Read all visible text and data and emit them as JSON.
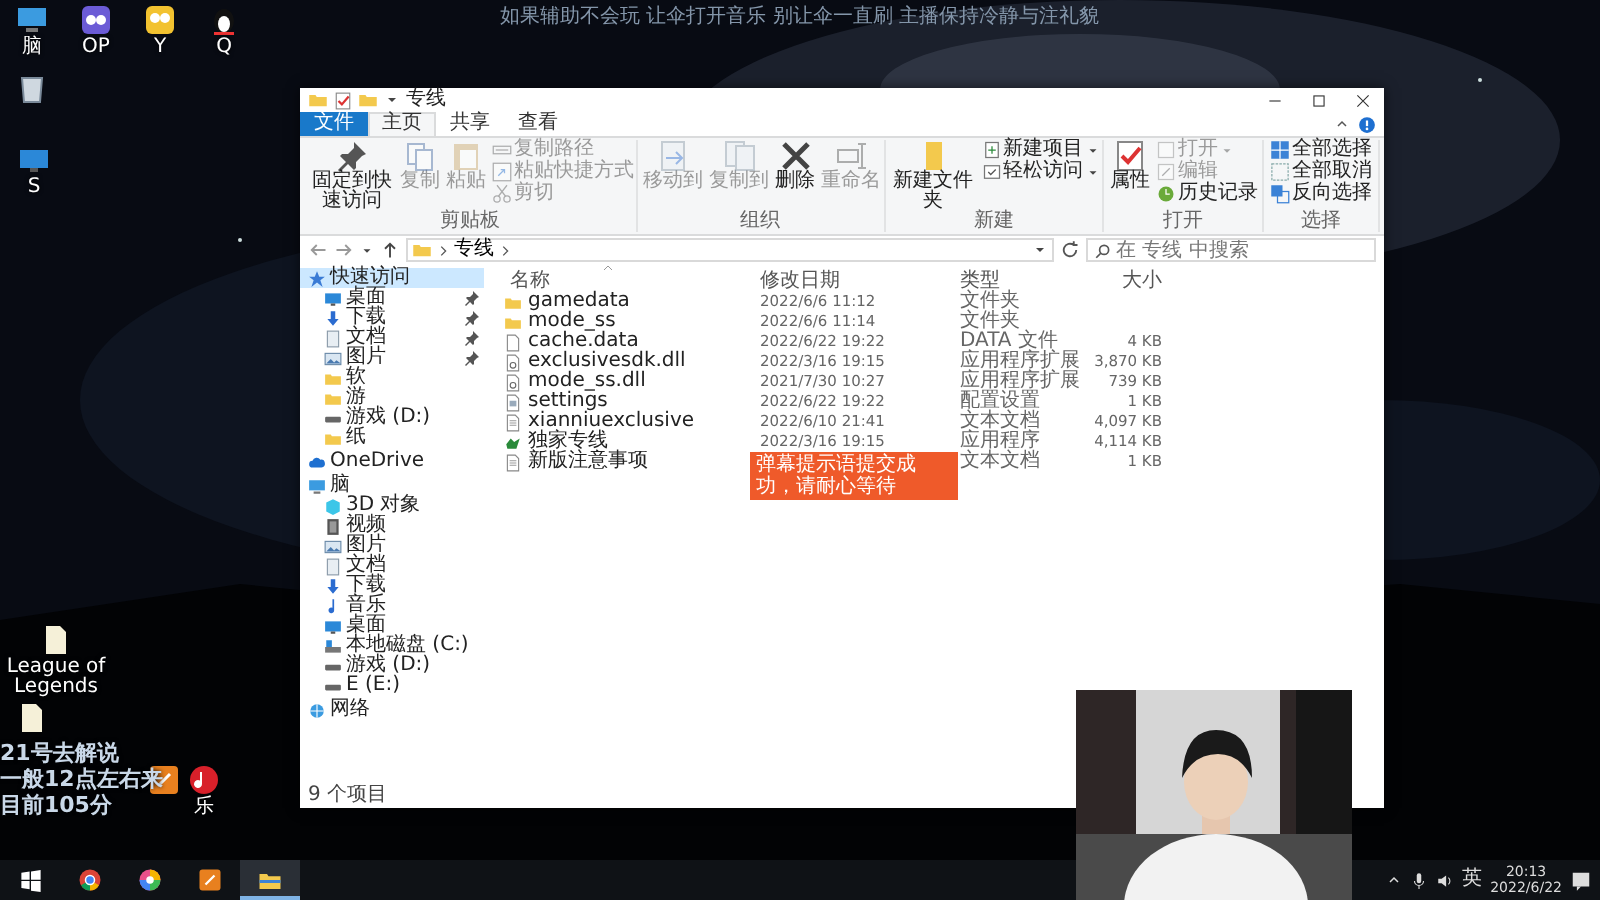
{
  "desktop": {
    "banner": "如果辅助不会玩 让伞打开音乐 别让伞一直刷 主播保持冷静与注礼貌",
    "icons": [
      {
        "label": "脑",
        "kind": "pc"
      },
      {
        "label": "OP",
        "kind": "op"
      },
      {
        "label": "Y",
        "kind": "owl"
      },
      {
        "label": "Q",
        "kind": "penguin"
      },
      {
        "kind": "recycle"
      },
      {
        "label": "S",
        "kind": "desktop"
      },
      {
        "label": "League of Legends",
        "kind": "page"
      },
      {
        "kind": "page"
      },
      {
        "kind": "orange"
      },
      {
        "label": "乐",
        "kind": "music"
      }
    ],
    "overlay_lines": [
      "21号去解说",
      "一般12点左右来",
      "目前105分"
    ]
  },
  "explorer": {
    "title": "专线",
    "ribbon_tabs": [
      {
        "label": "文件",
        "kind": "menu",
        "selected": false
      },
      {
        "label": "主页",
        "kind": "tab",
        "selected": true
      },
      {
        "label": "共享",
        "kind": "tab",
        "selected": false
      },
      {
        "label": "查看",
        "kind": "tab",
        "selected": false
      }
    ],
    "ribbon_groups": [
      {
        "label": "剪贴板",
        "items": [
          {
            "label": "固定到快速访问",
            "kind": "large",
            "disabled": false
          },
          {
            "label": "复制",
            "kind": "large",
            "disabled": true
          },
          {
            "label": "粘贴",
            "kind": "large",
            "disabled": true
          },
          {
            "label": "复制路径",
            "kind": "small",
            "disabled": true
          },
          {
            "label": "粘贴快捷方式",
            "kind": "small",
            "disabled": true
          },
          {
            "label": "剪切",
            "kind": "small",
            "disabled": true
          }
        ]
      },
      {
        "label": "组织",
        "items": [
          {
            "label": "移动到",
            "kind": "large",
            "disabled": true
          },
          {
            "label": "复制到",
            "kind": "large",
            "disabled": true
          },
          {
            "label": "删除",
            "kind": "large",
            "disabled": false
          },
          {
            "label": "重命名",
            "kind": "large",
            "disabled": true
          }
        ]
      },
      {
        "label": "新建",
        "items": [
          {
            "label": "新建文件夹",
            "kind": "large",
            "disabled": false
          },
          {
            "label": "新建项目",
            "kind": "small",
            "disabled": false,
            "dropdown": true
          },
          {
            "label": "轻松访问",
            "kind": "small",
            "disabled": false,
            "dropdown": true
          }
        ]
      },
      {
        "label": "打开",
        "items": [
          {
            "label": "属性",
            "kind": "large",
            "disabled": false
          },
          {
            "label": "打开",
            "kind": "small",
            "disabled": true,
            "dropdown": true
          },
          {
            "label": "编辑",
            "kind": "small",
            "disabled": true
          },
          {
            "label": "历史记录",
            "kind": "small",
            "disabled": false
          }
        ]
      },
      {
        "label": "选择",
        "items": [
          {
            "label": "全部选择",
            "kind": "small",
            "disabled": false
          },
          {
            "label": "全部取消",
            "kind": "small",
            "disabled": false
          },
          {
            "label": "反向选择",
            "kind": "small",
            "disabled": false
          }
        ]
      }
    ],
    "path": [
      "专线"
    ],
    "search": {
      "placeholder": "在 专线 中搜索"
    },
    "nav": [
      {
        "label": "快速访问",
        "kind": "star",
        "selected": true,
        "children": [
          {
            "label": "桌面",
            "kind": "desktop",
            "pinned": true,
            "selected": false
          },
          {
            "label": "下载",
            "kind": "download",
            "pinned": true,
            "selected": false
          },
          {
            "label": "文档",
            "kind": "doc",
            "pinned": true,
            "selected": false
          },
          {
            "label": "图片",
            "kind": "pic",
            "pinned": true,
            "selected": false
          },
          {
            "label": "软",
            "kind": "folder",
            "pinned": false,
            "selected": false
          },
          {
            "label": "游",
            "kind": "folder",
            "pinned": false,
            "selected": false
          },
          {
            "label": "游戏 (D:)",
            "kind": "drive",
            "pinned": false,
            "selected": false
          },
          {
            "label": "纸",
            "kind": "folder",
            "pinned": false,
            "selected": false
          }
        ]
      },
      {
        "label": "OneDrive",
        "kind": "cloud",
        "selected": false
      },
      {
        "label": "脑",
        "kind": "pc",
        "selected": false,
        "children": [
          {
            "label": "3D 对象",
            "kind": "cube",
            "selected": false
          },
          {
            "label": "视频",
            "kind": "video",
            "selected": false
          },
          {
            "label": "图片",
            "kind": "pic",
            "selected": false
          },
          {
            "label": "文档",
            "kind": "doc",
            "selected": false
          },
          {
            "label": "下载",
            "kind": "download",
            "selected": false
          },
          {
            "label": "音乐",
            "kind": "music",
            "selected": false
          },
          {
            "label": "桌面",
            "kind": "desktop",
            "selected": false
          },
          {
            "label": "本地磁盘 (C:)",
            "kind": "cdrive",
            "selected": false
          },
          {
            "label": "游戏 (D:)",
            "kind": "drive",
            "selected": false
          },
          {
            "label": "E (E:)",
            "kind": "drive",
            "selected": false
          }
        ]
      },
      {
        "label": "网络",
        "kind": "network",
        "selected": false
      }
    ],
    "columns": [
      "名称",
      "修改日期",
      "类型",
      "大小"
    ],
    "files": [
      {
        "name": "gamedata",
        "modified": "2022/6/6 11:12",
        "type": "文件夹",
        "kind": "folder"
      },
      {
        "name": "mode_ss",
        "modified": "2022/6/6 11:14",
        "type": "文件夹",
        "kind": "folder"
      },
      {
        "name": "cache.data",
        "modified": "2022/6/22 19:22",
        "type": "DATA 文件",
        "size": "4 KB",
        "kind": "file"
      },
      {
        "name": "exclusivesdk.dll",
        "modified": "2022/3/16 19:15",
        "type": "应用程序扩展",
        "size": "3,870 KB",
        "kind": "dll"
      },
      {
        "name": "mode_ss.dll",
        "modified": "2021/7/30 10:27",
        "type": "应用程序扩展",
        "size": "739 KB",
        "kind": "dll"
      },
      {
        "name": "settings",
        "modified": "2022/6/22 19:22",
        "type": "配置设置",
        "size": "1 KB",
        "kind": "settings"
      },
      {
        "name": "xianniuexclusive",
        "modified": "2022/6/10 21:41",
        "type": "文本文档",
        "size": "4,097 KB",
        "kind": "text"
      },
      {
        "name": "独家专线",
        "modified": "2022/3/16 19:15",
        "type": "应用程序",
        "size": "4,114 KB",
        "kind": "app"
      },
      {
        "name": "新版注意事项",
        "type": "文本文档",
        "size": "1 KB",
        "kind": "text"
      }
    ],
    "toast": "弹幕提示语提交成功，请耐心等待",
    "status": "9 个项目"
  },
  "taskbar": {
    "apps": [
      {
        "kind": "chrome",
        "active": false
      },
      {
        "kind": "browser",
        "active": false
      },
      {
        "kind": "orange",
        "active": false
      },
      {
        "kind": "explorer",
        "active": true
      }
    ],
    "ime": "英",
    "time": "20:13",
    "date": "2022/6/22"
  }
}
